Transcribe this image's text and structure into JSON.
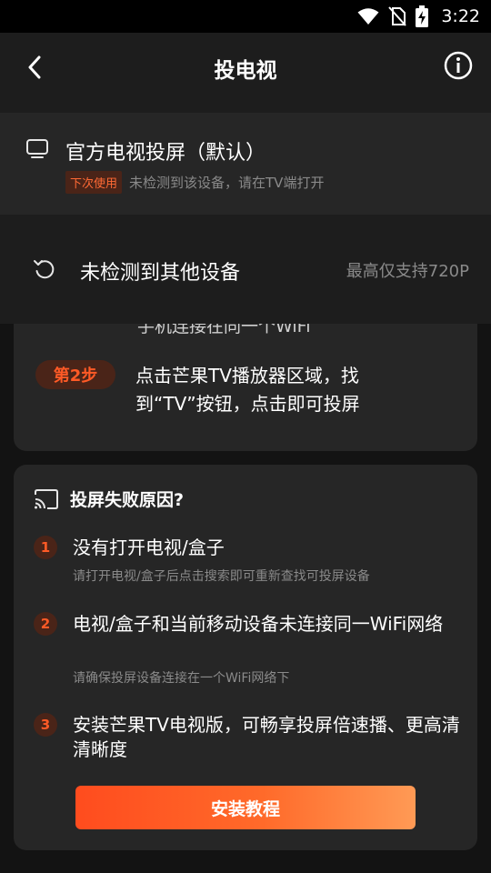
{
  "status": {
    "time": "3:22"
  },
  "nav": {
    "title": "投电视"
  },
  "official": {
    "title": "官方电视投屏（默认）",
    "badge": "下次使用",
    "subtitle": "未检测到该设备，请在TV端打开"
  },
  "others": {
    "label": "未检测到其他设备",
    "limit": "最高仅支持720P"
  },
  "steps": {
    "partial_text": "手机连接在同一个WiFi",
    "step2_badge": "第2步",
    "step2_text": "点击芒果TV播放器区域，找到“TV”按钮，点击即可投屏"
  },
  "reasons": {
    "title": "投屏失败原因?",
    "items": [
      {
        "num": "1",
        "title": "没有打开电视/盒子",
        "sub": "请打开电视/盒子后点击搜索即可重新查找可投屏设备"
      },
      {
        "num": "2",
        "title": "电视/盒子和当前移动设备未连接同一WiFi网络",
        "sub": "请确保投屏设备连接在一个WiFi网络下"
      },
      {
        "num": "3",
        "title": "安装芒果TV电视版，可畅享投屏倍速播、更高清清晰度",
        "sub": ""
      }
    ],
    "install_button": "安装教程"
  },
  "colors": {
    "accent": "#ff5a26",
    "badge_bg": "#4a2418"
  }
}
